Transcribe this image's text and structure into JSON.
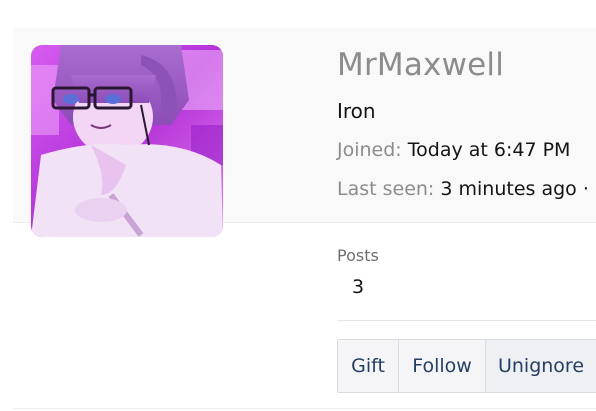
{
  "profile": {
    "username": "MrMaxwell",
    "rank": "Iron",
    "joined_label": "Joined:",
    "joined_value": "Today at 6:47 PM",
    "last_seen_label": "Last seen:",
    "last_seen_value": "3 minutes ago ·",
    "avatar_icon": "user-avatar-image"
  },
  "stats": {
    "posts_label": "Posts",
    "posts_value": "3"
  },
  "actions": {
    "gift_label": "Gift",
    "follow_label": "Follow",
    "unignore_label": "Unignore"
  },
  "colors": {
    "username": "#8c8c8c",
    "button_text": "#243f63",
    "avatar_tint": "#c23be0"
  }
}
